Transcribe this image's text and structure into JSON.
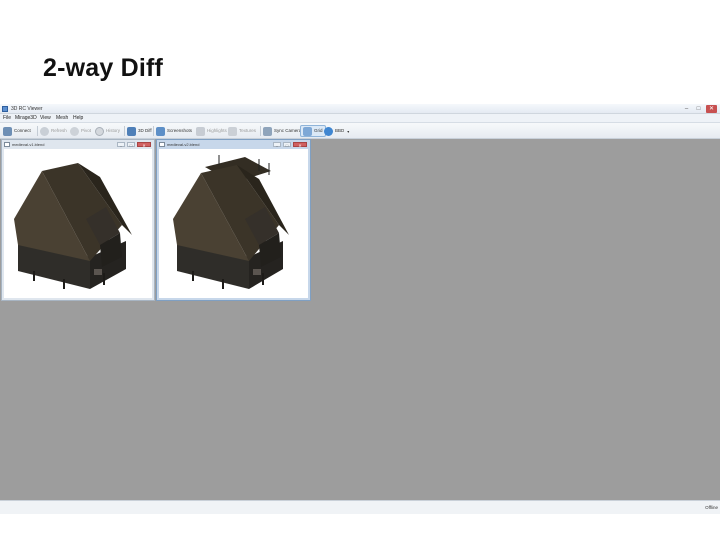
{
  "slide": {
    "title": "2-way Diff"
  },
  "app": {
    "title": "3D RC Viewer",
    "menu": [
      "File",
      "Mirage3D",
      "View",
      "Mesh",
      "Help"
    ],
    "toolbar": [
      {
        "label": "Connect",
        "icon": "connect-icon",
        "enabled": true
      },
      {
        "label": "Refresh",
        "icon": "refresh-icon",
        "enabled": false
      },
      {
        "label": "Pivot",
        "icon": "pivot-icon",
        "enabled": false
      },
      {
        "label": "History",
        "icon": "history-icon",
        "enabled": false
      },
      {
        "label": "3D Diff",
        "icon": "diff-icon",
        "enabled": true
      },
      {
        "label": "Screenshots",
        "icon": "screenshots-icon",
        "enabled": true
      },
      {
        "label": "Highlights",
        "icon": "highlight-icon",
        "enabled": false
      },
      {
        "label": "Textures",
        "icon": "textures-icon",
        "enabled": false
      },
      {
        "label": "Sync Camera",
        "icon": "sync-camera-icon",
        "enabled": true
      },
      {
        "label": "Grid",
        "icon": "grid-icon",
        "enabled": true,
        "selected": true
      },
      {
        "label": "BBD",
        "icon": "bbd-icon",
        "enabled": true
      }
    ],
    "windows": [
      {
        "title": "medieval-v1.blend"
      },
      {
        "title": "medieval-v2.blend"
      }
    ],
    "status": "Offline",
    "window_controls": {
      "minimize": "–",
      "maximize": "□",
      "close": "✕"
    }
  },
  "colors": {
    "workspace": "#9d9d9d",
    "roof": "#3b3428",
    "roof_dark": "#2a251c",
    "wall": "#2f2d29",
    "accent": "#5b8fd0"
  }
}
